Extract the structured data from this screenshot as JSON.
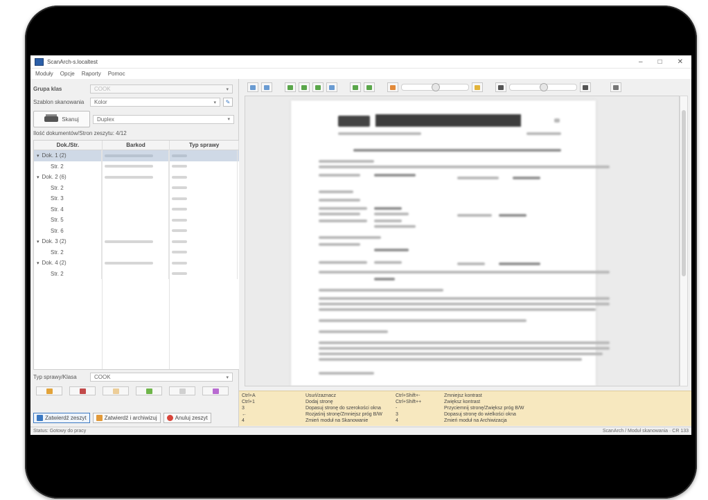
{
  "window": {
    "title": "ScanArch-s.localtest",
    "minimize": "–",
    "maximize": "□",
    "close": "✕"
  },
  "menu": [
    "Moduły",
    "Opcje",
    "Raporty",
    "Pomoc"
  ],
  "left": {
    "group_label": "Grupa klas",
    "group_value": "COOK",
    "template_label": "Szablon skanowania",
    "template_value": "Kolor",
    "scan_button": "Skanuj",
    "duplex_value": "Duplex",
    "counter": "Ilość dokumentów/Stron zeszytu: 4/12",
    "table": {
      "headers": [
        "Dok./Str.",
        "Barkod",
        "Typ sprawy"
      ],
      "rows": [
        {
          "label": "Dok. 1 (2)",
          "level": 0,
          "expanded": true,
          "selected": true
        },
        {
          "label": "Str. 2",
          "level": 1
        },
        {
          "label": "Dok. 2 (6)",
          "level": 0,
          "expanded": true
        },
        {
          "label": "Str. 2",
          "level": 1
        },
        {
          "label": "Str. 3",
          "level": 1
        },
        {
          "label": "Str. 4",
          "level": 1
        },
        {
          "label": "Str. 5",
          "level": 1
        },
        {
          "label": "Str. 6",
          "level": 1
        },
        {
          "label": "Dok. 3 (2)",
          "level": 0,
          "expanded": true
        },
        {
          "label": "Str. 2",
          "level": 1
        },
        {
          "label": "Dok. 4 (2)",
          "level": 0,
          "expanded": true
        },
        {
          "label": "Str. 2",
          "level": 1
        }
      ]
    },
    "type_label": "Typ sprawy/Klasa",
    "type_value": "COOK",
    "actions": {
      "close": "Zatwierdź zeszyt",
      "archive": "Zatwierdź i archiwizuj",
      "cancel": "Anuluj zeszyt"
    }
  },
  "shortcuts": {
    "col1_keys": [
      "Ctrl+A",
      "Ctrl+1",
      "3",
      "←",
      "4"
    ],
    "col1_desc": [
      "Usuń/zaznacz",
      "Dodaj stronę",
      "Dopasuj stronę do szerokości okna",
      "Rozjaśnij stronę/Zmniejsz próg B/W",
      "Zmień moduł na Skanowanie"
    ],
    "col2_keys": [
      "Ctrl+Shift+-",
      "Ctrl+Shift++",
      "-",
      "3",
      "4"
    ],
    "col2_desc": [
      "Zmniejsz kontrast",
      "Zwiększ kontrast",
      "Przyciemnij stronę/Zwiększ próg B/W",
      "Dopasuj stronę do wielkości okna",
      "Zmień moduł na Archiwizacja"
    ]
  },
  "status": {
    "left": "Status: Gotowy do pracy",
    "right": "ScanArch / Moduł skanowania · CR 133"
  },
  "colors": {
    "accent": "#3a78c2",
    "shortcut_bg": "#f7e8bf",
    "selected_row": "#cfd9e6"
  }
}
